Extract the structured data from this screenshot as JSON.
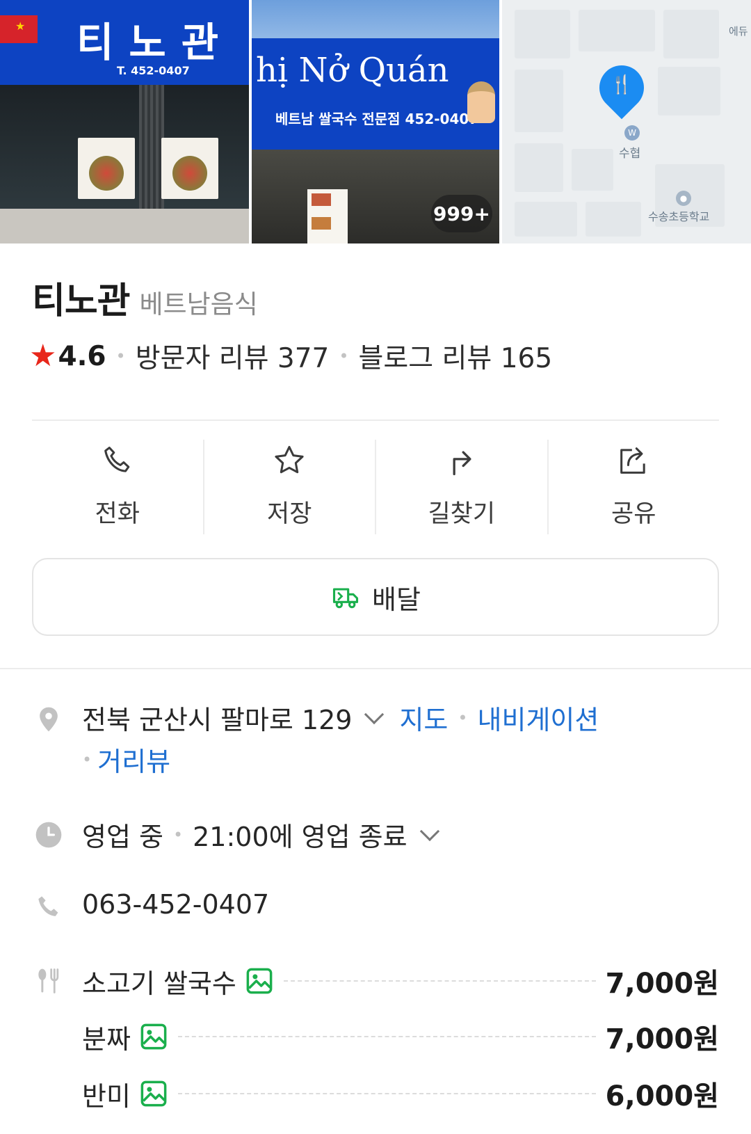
{
  "photos": {
    "shop_sign_text": "티노관",
    "shop_sign_phone": "T. 452-0407",
    "sign2_title": "hị Nở Quán",
    "sign2_subtitle": "베트남 쌀국수 전문점 452-0407",
    "photo_count": "999+",
    "map_labels": {
      "bank": "수협",
      "school": "수송초등학교",
      "corner": "에듀"
    }
  },
  "place": {
    "name": "티노관",
    "category": "베트남음식",
    "rating": "4.6",
    "visitor_reviews": "방문자 리뷰 377",
    "blog_reviews": "블로그 리뷰 165"
  },
  "actions": [
    {
      "label": "전화",
      "icon": "phone-icon"
    },
    {
      "label": "저장",
      "icon": "star-outline-icon"
    },
    {
      "label": "길찾기",
      "icon": "directions-icon"
    },
    {
      "label": "공유",
      "icon": "share-icon"
    }
  ],
  "delivery": {
    "label": "배달",
    "icon": "delivery-truck-icon",
    "icon_color": "#1aaf4c"
  },
  "info": {
    "address": "전북 군산시 팔마로 129",
    "map_link": "지도",
    "navigation_link": "내비게이션",
    "street_view_link": "거리뷰",
    "status": "영업 중",
    "hours": "21:00에 영업 종료",
    "phone": "063-452-0407"
  },
  "menu": [
    {
      "name": "소고기 쌀국수",
      "price": "7,000원"
    },
    {
      "name": "분짜",
      "price": "7,000원"
    },
    {
      "name": "반미",
      "price": "6,000원"
    }
  ],
  "colors": {
    "link": "#1f6fd1",
    "star": "#e8271b",
    "map_pin": "#1b8cf2",
    "image_badge": "#1aaf4c"
  }
}
